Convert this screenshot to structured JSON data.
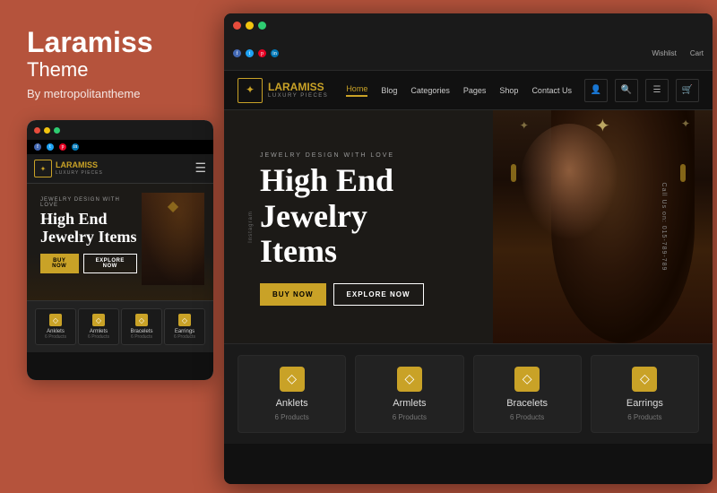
{
  "brand": {
    "name": "Laramiss",
    "subtitle": "Theme",
    "by": "By metropolitantheme",
    "logoText": "LARAMISS",
    "logoSub": "LUXURY PIECES"
  },
  "nav": {
    "social": [
      "f",
      "t",
      "p",
      "in"
    ],
    "links": [
      "Wishlist",
      "Cart"
    ],
    "mainLinks": [
      "Home",
      "Blog",
      "Categories",
      "Pages",
      "Shop",
      "Contact Us"
    ],
    "activeLink": "Home"
  },
  "hero": {
    "smallText": "JEWELRY DESIGN WITH LOVE",
    "title": "High End\nJewelry\nItems",
    "btnBuy": "BUY NOW",
    "btnExplore": "EXPLORE NOW",
    "sideLeft": "Instagram",
    "sideRight": "Call Us on: 015-789-789"
  },
  "categories": [
    {
      "icon": "◇",
      "name": "Anklets",
      "count": "6 Products"
    },
    {
      "icon": "◇",
      "name": "Armlets",
      "count": "6 Products"
    },
    {
      "icon": "◇",
      "name": "Bracelets",
      "count": "6 Products"
    },
    {
      "icon": "◇",
      "name": "Earrings",
      "count": "6 Products"
    }
  ],
  "mobileCategories": [
    {
      "icon": "◇",
      "name": "Anklets",
      "count": "6 Products"
    }
  ],
  "colors": {
    "gold": "#c9a227",
    "bg": "#b5533c",
    "dark": "#111111",
    "navBg": "#1a1a1a"
  }
}
